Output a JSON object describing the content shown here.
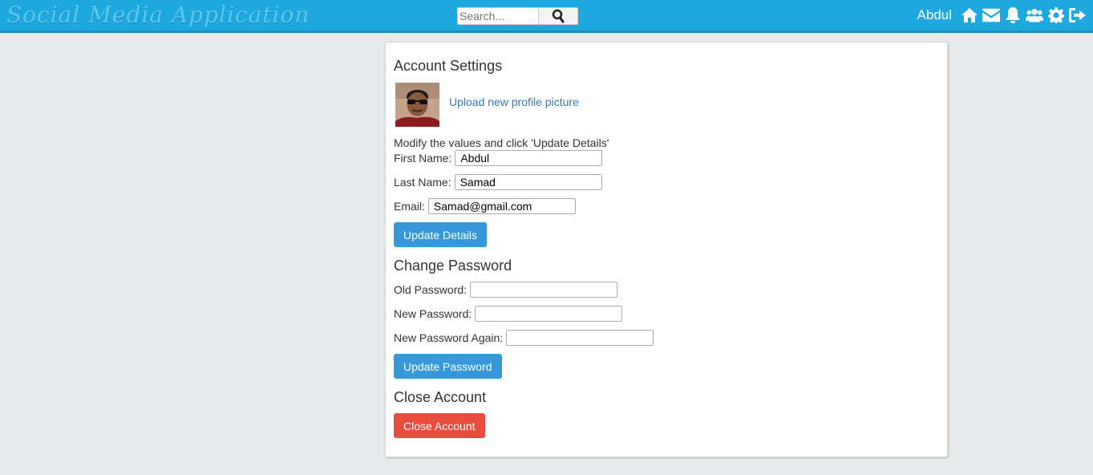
{
  "app": {
    "title": "Social Media Application"
  },
  "search": {
    "placeholder": "Search..."
  },
  "nav": {
    "username": "Abdul",
    "icons": [
      "home-icon",
      "envelope-icon",
      "bell-icon",
      "users-icon",
      "gear-icon",
      "sign-out-icon"
    ]
  },
  "settings": {
    "title": "Account Settings",
    "upload_link": "Upload new profile picture",
    "note": "Modify the values and click 'Update Details'",
    "first_name_label": "First Name:",
    "first_name_value": "Abdul",
    "last_name_label": "Last Name:",
    "last_name_value": "Samad",
    "email_label": "Email:",
    "email_value": "Samad@gmail.com",
    "update_details": "Update Details"
  },
  "password": {
    "title": "Change Password",
    "old_label": "Old Password:",
    "new_label": "New Password:",
    "again_label": "New Password Again:",
    "update_password": "Update Password"
  },
  "close": {
    "title": "Close Account",
    "button": "Close Account"
  },
  "colors": {
    "topbar": "#1ea8e0",
    "primary": "#3498db",
    "danger": "#e74c3c",
    "link": "#337ab7"
  }
}
